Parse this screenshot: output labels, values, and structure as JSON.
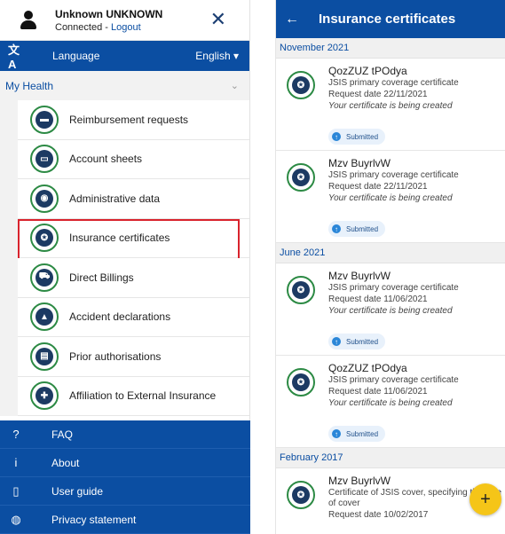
{
  "user": {
    "name": "Unknown UNKNOWN",
    "status_prefix": "Connected - ",
    "logout": "Logout"
  },
  "language": {
    "label": "Language",
    "value": "English ▾"
  },
  "section": {
    "title": "My Health",
    "chevron": "⌄"
  },
  "menu": [
    {
      "label": "Reimbursement requests",
      "icon": "wallet-icon",
      "glyph": "▬"
    },
    {
      "label": "Account sheets",
      "icon": "card-icon",
      "glyph": "▭"
    },
    {
      "label": "Administrative data",
      "icon": "id-icon",
      "glyph": "◉"
    },
    {
      "label": "Insurance certificates",
      "icon": "certificate-icon",
      "glyph": "✪"
    },
    {
      "label": "Direct Billings",
      "icon": "billing-icon",
      "glyph": "⛟"
    },
    {
      "label": "Accident declarations",
      "icon": "warning-icon",
      "glyph": "▲"
    },
    {
      "label": "Prior authorisations",
      "icon": "document-icon",
      "glyph": "▤"
    },
    {
      "label": "Affiliation to External Insurance",
      "icon": "puzzle-icon",
      "glyph": "✚"
    }
  ],
  "footer": [
    {
      "label": "FAQ",
      "glyph": "?"
    },
    {
      "label": "About",
      "glyph": "i"
    },
    {
      "label": "User guide",
      "glyph": "▯"
    },
    {
      "label": "Privacy statement",
      "glyph": "◍"
    }
  ],
  "right": {
    "title": "Insurance certificates",
    "back": "←",
    "groups": [
      {
        "label": "November 2021",
        "items": [
          {
            "name": "QozZUZ tPOdya",
            "type": "JSIS primary coverage certificate",
            "date": "Request date 22/11/2021",
            "note": "Your certificate is being created",
            "status": "Submitted"
          },
          {
            "name": "Mzv BuyrlvW",
            "type": "JSIS primary coverage certificate",
            "date": "Request date 22/11/2021",
            "note": "Your certificate is being created",
            "status": "Submitted"
          }
        ]
      },
      {
        "label": "June 2021",
        "items": [
          {
            "name": "Mzv BuyrlvW",
            "type": "JSIS primary coverage certificate",
            "date": "Request date 11/06/2021",
            "note": "Your certificate is being created",
            "status": "Submitted"
          },
          {
            "name": "QozZUZ tPOdya",
            "type": "JSIS primary coverage certificate",
            "date": "Request date 11/06/2021",
            "note": "Your certificate is being created",
            "status": "Submitted"
          }
        ]
      },
      {
        "label": "February 2017",
        "items": [
          {
            "name": "Mzv BuyrlvW",
            "type": "Certificate of JSIS cover, specifying the type of cover",
            "date": "Request date 10/02/2017"
          }
        ]
      }
    ],
    "fab": "+"
  },
  "colors": {
    "primary": "#0b4ea2",
    "accent_green": "#2c8a44",
    "highlight": "#d9232d",
    "fab": "#f5c518"
  }
}
